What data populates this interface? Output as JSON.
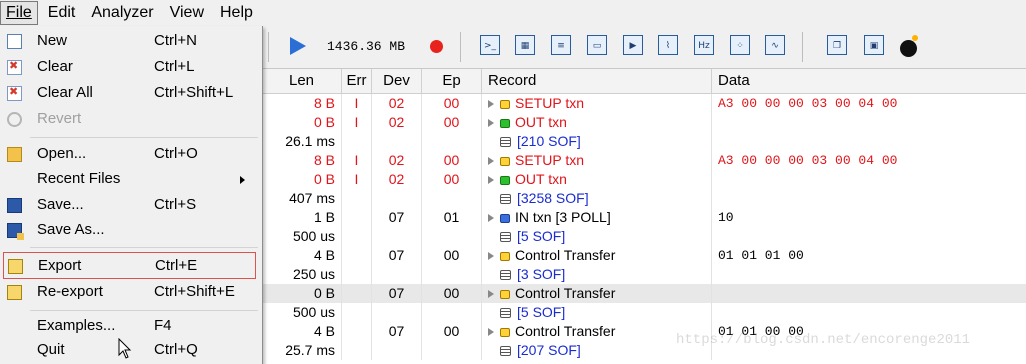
{
  "menubar": [
    "File",
    "Edit",
    "Analyzer",
    "View",
    "Help"
  ],
  "toolbar": {
    "capture_size": "1436.36 MB"
  },
  "file_menu": [
    {
      "label": "New",
      "shortcut": "Ctrl+N",
      "icon": "new-file-icon",
      "disabled": false
    },
    {
      "label": "Clear",
      "shortcut": "Ctrl+L",
      "icon": "clear-icon",
      "disabled": false
    },
    {
      "label": "Clear All",
      "shortcut": "Ctrl+Shift+L",
      "icon": "clear-all-icon",
      "disabled": false
    },
    {
      "label": "Revert",
      "shortcut": "",
      "icon": "revert-icon",
      "disabled": true
    },
    {
      "label": "Open...",
      "shortcut": "Ctrl+O",
      "icon": "open-folder-icon",
      "disabled": false
    },
    {
      "label": "Recent Files",
      "shortcut": "",
      "icon": "",
      "disabled": false,
      "submenu": true
    },
    {
      "label": "Save...",
      "shortcut": "Ctrl+S",
      "icon": "save-icon",
      "disabled": false
    },
    {
      "label": "Save As...",
      "shortcut": "",
      "icon": "save-as-icon",
      "disabled": false
    },
    {
      "label": "Export",
      "shortcut": "Ctrl+E",
      "icon": "export-icon",
      "disabled": false,
      "highlighted": true
    },
    {
      "label": "Re-export",
      "shortcut": "Ctrl+Shift+E",
      "icon": "reexport-icon",
      "disabled": false
    },
    {
      "label": "Examples...",
      "shortcut": "F4",
      "icon": "",
      "disabled": false
    },
    {
      "label": "Quit",
      "shortcut": "Ctrl+Q",
      "icon": "",
      "disabled": false
    }
  ],
  "table": {
    "columns": [
      "Len",
      "Err",
      "Dev",
      "Ep",
      "Record",
      "Data"
    ],
    "rows": [
      {
        "len": "8 B",
        "err": "I",
        "dev": "02",
        "ep": "00",
        "record": "SETUP txn",
        "data": "A3 00 00 00 03 00 04 00",
        "color": "red",
        "icon": "yellow"
      },
      {
        "len": "0 B",
        "err": "I",
        "dev": "02",
        "ep": "00",
        "record": "OUT txn",
        "data": "",
        "color": "red",
        "icon": "green"
      },
      {
        "len": "26.1 ms",
        "err": "",
        "dev": "",
        "ep": "",
        "record": "[210 SOF]",
        "data": "",
        "color": "sof",
        "icon": "stack"
      },
      {
        "len": "8 B",
        "err": "I",
        "dev": "02",
        "ep": "00",
        "record": "SETUP txn",
        "data": "A3 00 00 00 03 00 04 00",
        "color": "red",
        "icon": "yellow"
      },
      {
        "len": "0 B",
        "err": "I",
        "dev": "02",
        "ep": "00",
        "record": "OUT txn",
        "data": "",
        "color": "red",
        "icon": "green"
      },
      {
        "len": "407 ms",
        "err": "",
        "dev": "",
        "ep": "",
        "record": "[3258 SOF]",
        "data": "",
        "color": "sof",
        "icon": "stack"
      },
      {
        "len": "1 B",
        "err": "",
        "dev": "07",
        "ep": "01",
        "record": "IN txn   [3 POLL]",
        "data": "10",
        "color": "black",
        "icon": "blue"
      },
      {
        "len": "500 us",
        "err": "",
        "dev": "",
        "ep": "",
        "record": "[5 SOF]",
        "data": "",
        "color": "sof",
        "icon": "stack"
      },
      {
        "len": "4 B",
        "err": "",
        "dev": "07",
        "ep": "00",
        "record": "Control Transfer",
        "data": "01 01 01 00",
        "color": "black",
        "icon": "yellow"
      },
      {
        "len": "250 us",
        "err": "",
        "dev": "",
        "ep": "",
        "record": "[3 SOF]",
        "data": "",
        "color": "sof",
        "icon": "stack"
      },
      {
        "len": "0 B",
        "err": "",
        "dev": "07",
        "ep": "00",
        "record": "Control Transfer",
        "data": "",
        "color": "black",
        "icon": "yellow",
        "group": true
      },
      {
        "len": "500 us",
        "err": "",
        "dev": "",
        "ep": "",
        "record": "[5 SOF]",
        "data": "",
        "color": "sof",
        "icon": "stack"
      },
      {
        "len": "4 B",
        "err": "",
        "dev": "07",
        "ep": "00",
        "record": "Control Transfer",
        "data": "01 01 00 00",
        "color": "black",
        "icon": "yellow"
      },
      {
        "len": "25.7 ms",
        "err": "",
        "dev": "",
        "ep": "",
        "record": "[207 SOF]",
        "data": "",
        "color": "sof",
        "icon": "stack"
      }
    ]
  },
  "watermark": "https://blog.csdn.net/encorenge2011",
  "colors": {
    "red_text": "#e0141a",
    "sof_blue": "#1a2cd0",
    "highlight_border": "#d9534f"
  }
}
